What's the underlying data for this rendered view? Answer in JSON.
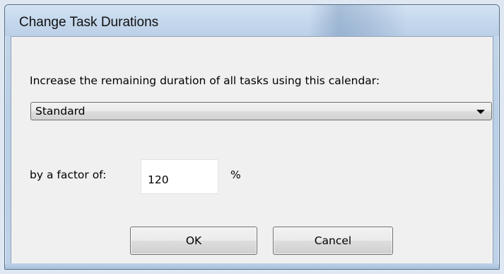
{
  "window": {
    "title": "Change Task Durations"
  },
  "dialog": {
    "prompt": "Increase the remaining duration of all tasks using this calendar:",
    "calendar_select": {
      "selected": "Standard"
    },
    "factor_label": "by a factor of:",
    "factor_value": "120",
    "factor_unit": "%"
  },
  "buttons": {
    "ok_label": "OK",
    "cancel_label": "Cancel"
  },
  "colors": {
    "titlebar": "#c4d7ec",
    "client_background": "#f0f0f0",
    "input_background": "#ffffff"
  },
  "icons": {
    "dropdown": "chevron-down-icon"
  }
}
